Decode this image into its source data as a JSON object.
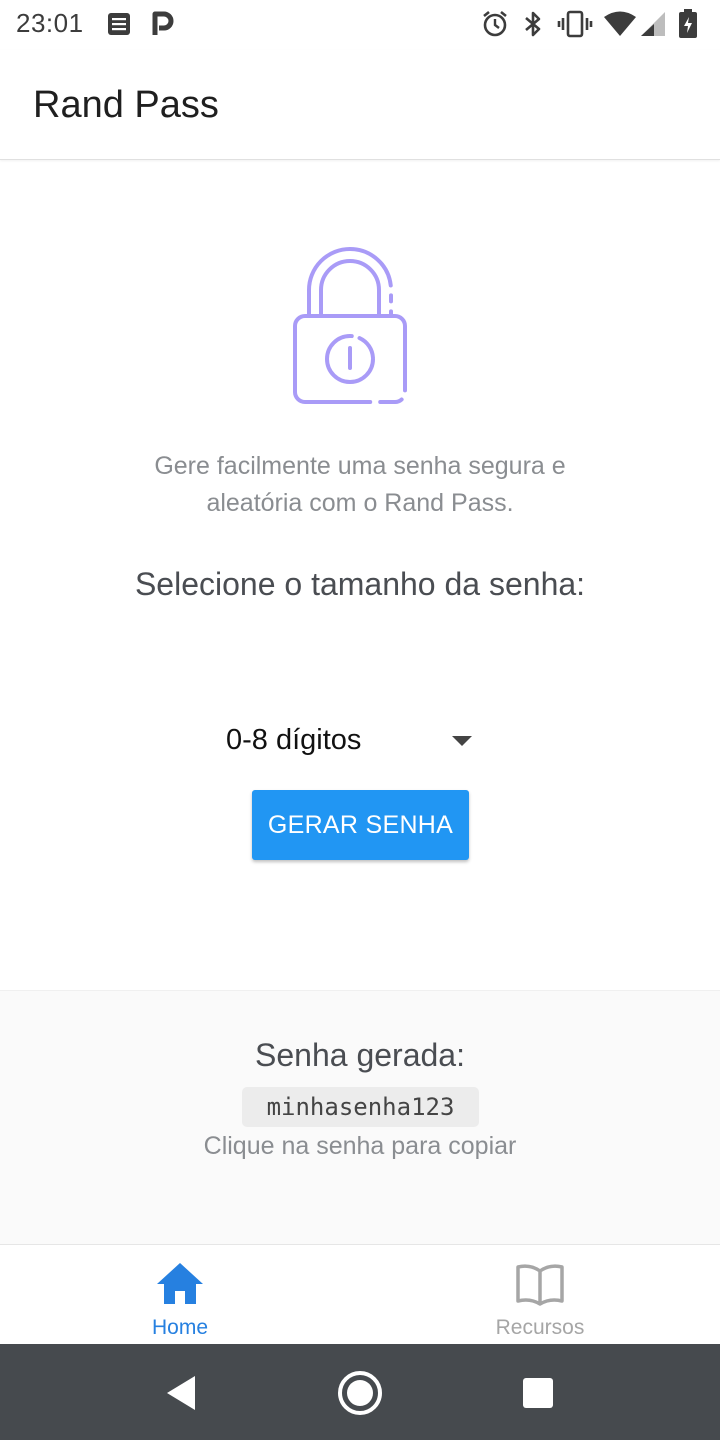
{
  "status_bar": {
    "time": "23:01",
    "icons": [
      "notes-icon",
      "parking-icon",
      "alarm-icon",
      "bluetooth-icon",
      "vibrate-icon",
      "wifi-icon",
      "signal-icon",
      "battery-icon"
    ]
  },
  "app_bar": {
    "title": "Rand Pass"
  },
  "main": {
    "icon": "lock-icon",
    "intro_line1": "Gere facilmente uma senha segura e",
    "intro_line2": "aleatória com o Rand Pass.",
    "select_heading": "Selecione o tamanho da senha:",
    "dropdown": {
      "selected": "0-8 dígitos"
    },
    "generate_button": "GERAR SENHA"
  },
  "result": {
    "label": "Senha gerada:",
    "password": "minhasenha123",
    "hint": "Clique na senha para copiar"
  },
  "tabs": [
    {
      "label": "Home",
      "icon": "home-icon",
      "active": true
    },
    {
      "label": "Recursos",
      "icon": "book-icon",
      "active": false
    }
  ],
  "colors": {
    "accent": "#2196f3",
    "lock": "#a99bf7",
    "tab_active": "#2680e0",
    "tab_inactive": "#a6a6a6",
    "nav_bar": "#464a4e"
  },
  "nav": [
    "back-icon",
    "home-circle-icon",
    "recents-icon"
  ]
}
